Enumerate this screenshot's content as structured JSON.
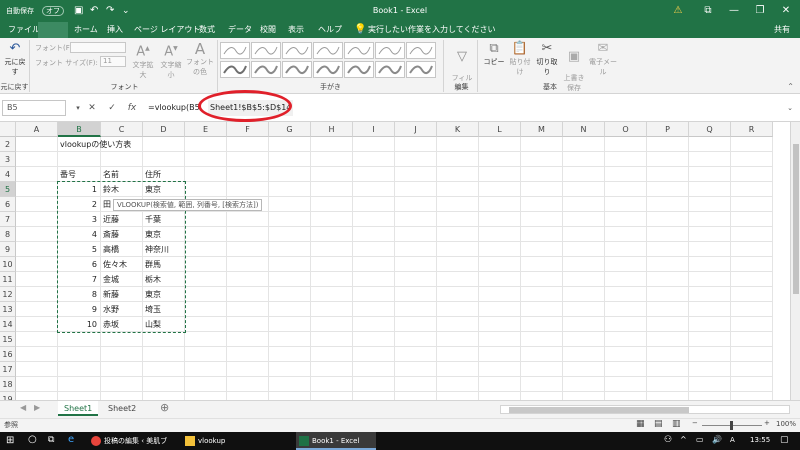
{
  "titlebar": {
    "autosave_label": "自動保存",
    "autosave_state": "オフ",
    "title": "Book1  -  Excel",
    "warning_icon": "warning-icon",
    "minimize": "—",
    "restore": "❐",
    "close": "✕",
    "ribbon_toggle": "⧉"
  },
  "tabs": [
    "ファイル",
    "ホーム",
    "挿入",
    "ページ レイアウト",
    "数式",
    "データ",
    "校閲",
    "表示",
    "ヘルプ"
  ],
  "active_tab": "ホーム",
  "tell_me": "実行したい作業を入力してください",
  "share": "共有",
  "ribbon": {
    "undo_label": "元に戻す",
    "undo_group": "元に戻す",
    "font_label": "フォント(F):",
    "font_size_label": "フォント サイズ(F):",
    "font_size_value": "11",
    "grow": "文字拡大",
    "shrink": "文字縮小",
    "font_color": "フォントの色",
    "font_group": "フォント",
    "handwriting_group": "手がき",
    "filter": "フィル\nター",
    "edit_group": "編集",
    "copy": "コピー",
    "paste": "貼り付け",
    "cut": "切り取り",
    "overwrite": "上書き\n保存",
    "email": "電子メール",
    "basic_group": "基本"
  },
  "formula_bar": {
    "name_box": "B5",
    "cancel": "✕",
    "enter": "✓",
    "fx": "fx",
    "formula_prefix": "=vlookup(B5,",
    "formula_highlight": "Sheet1!$B$5:$D$14"
  },
  "columns": [
    "A",
    "B",
    "C",
    "D",
    "E",
    "F",
    "G",
    "H",
    "I",
    "J",
    "K",
    "L",
    "M",
    "N",
    "O",
    "P",
    "Q",
    "R"
  ],
  "rows": [
    "2",
    "3",
    "4",
    "5",
    "6",
    "7",
    "8",
    "9",
    "10",
    "11",
    "12",
    "13",
    "14",
    "15",
    "16",
    "17",
    "18",
    "19"
  ],
  "sheet": {
    "title": "vlookupの使い方表",
    "headers": [
      "番号",
      "名前",
      "住所"
    ],
    "data": [
      [
        "1",
        "鈴木",
        "東京"
      ],
      [
        "2",
        "田",
        ""
      ],
      [
        "3",
        "近藤",
        "千葉"
      ],
      [
        "4",
        "斎藤",
        "東京"
      ],
      [
        "5",
        "高橋",
        "神奈川"
      ],
      [
        "6",
        "佐々木",
        "群馬"
      ],
      [
        "7",
        "金城",
        "栃木"
      ],
      [
        "8",
        "新藤",
        "東京"
      ],
      [
        "9",
        "水野",
        "埼玉"
      ],
      [
        "10",
        "赤坂",
        "山梨"
      ]
    ]
  },
  "tooltip": "VLOOKUP(検索値, 範囲, 列番号, [検索方法])",
  "sheet_tabs": [
    "Sheet1",
    "Sheet2"
  ],
  "add_sheet": "⊕",
  "status": {
    "mode": "参照",
    "zoom": "100%"
  },
  "taskbar": {
    "items": [
      "投稿の編集 ‹ 美肌ブレ...",
      "vlookup",
      "Book1 - Excel"
    ],
    "ime": "A",
    "time": "13:55"
  },
  "colors": {
    "excel_green": "#217346",
    "annotation_red": "#e0202a"
  }
}
